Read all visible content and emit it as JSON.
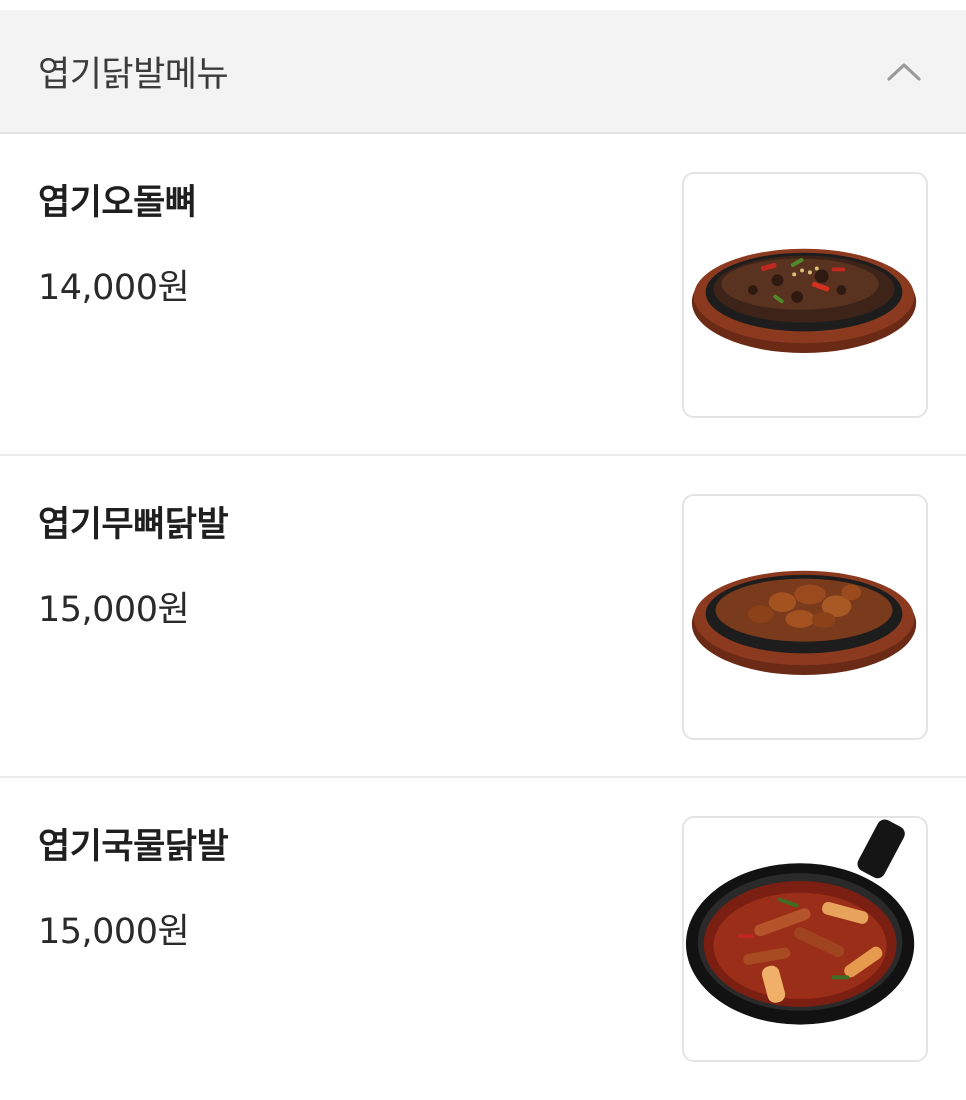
{
  "section": {
    "title": "엽기닭발메뉴",
    "toggle_icon": "chevron-up-icon"
  },
  "items": [
    {
      "name": "엽기오돌뼈",
      "price": "14,000원",
      "image": "sizzling-plate-cartilage"
    },
    {
      "name": "엽기무뼈닭발",
      "price": "15,000원",
      "image": "sizzling-plate-boneless-feet"
    },
    {
      "name": "엽기국물닭발",
      "price": "15,000원",
      "image": "pan-soup-chicken-feet"
    }
  ],
  "colors": {
    "header_bg": "#f3f3f3",
    "divider": "#ececec",
    "text": "#1f1f1f"
  }
}
